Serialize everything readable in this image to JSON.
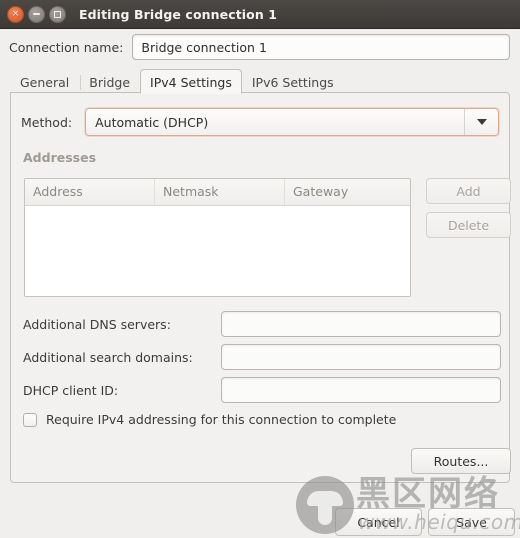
{
  "window": {
    "title": "Editing Bridge connection 1",
    "controls": {
      "close": "close-button",
      "minimize": "minimize-button",
      "maximize": "maximize-button"
    }
  },
  "connection": {
    "name_label": "Connection name:",
    "name_value": "Bridge connection 1",
    "name_placeholder": ""
  },
  "tabs": [
    {
      "label": "General",
      "active": false
    },
    {
      "label": "Bridge",
      "active": false
    },
    {
      "label": "IPv4 Settings",
      "active": true
    },
    {
      "label": "IPv6 Settings",
      "active": false
    }
  ],
  "ipv4": {
    "method_label": "Method:",
    "method_value": "Automatic (DHCP)",
    "addresses_title": "Addresses",
    "table": {
      "columns": [
        "Address",
        "Netmask",
        "Gateway"
      ],
      "rows": []
    },
    "add_label": "Add",
    "delete_label": "Delete",
    "fields": [
      {
        "label": "Additional DNS servers:",
        "value": "",
        "placeholder": ""
      },
      {
        "label": "Additional search domains:",
        "value": "",
        "placeholder": ""
      },
      {
        "label": "DHCP client ID:",
        "value": "",
        "placeholder": ""
      }
    ],
    "require_ipv4_label": "Require IPv4 addressing for this connection to complete",
    "require_ipv4_checked": false,
    "routes_label": "Routes..."
  },
  "actions": {
    "cancel_label": "Cancel",
    "save_label": "Save"
  },
  "watermark": {
    "chinese": "黑区网络",
    "url": "www.heiqu.com"
  },
  "colors": {
    "titlebar": "#3d3a37",
    "close_accent": "#e2663a",
    "window_bg": "#f0efed",
    "panel_bg": "#f2f1ef",
    "focus_border": "#e0a98f",
    "disabled_text": "#a7a29d"
  }
}
